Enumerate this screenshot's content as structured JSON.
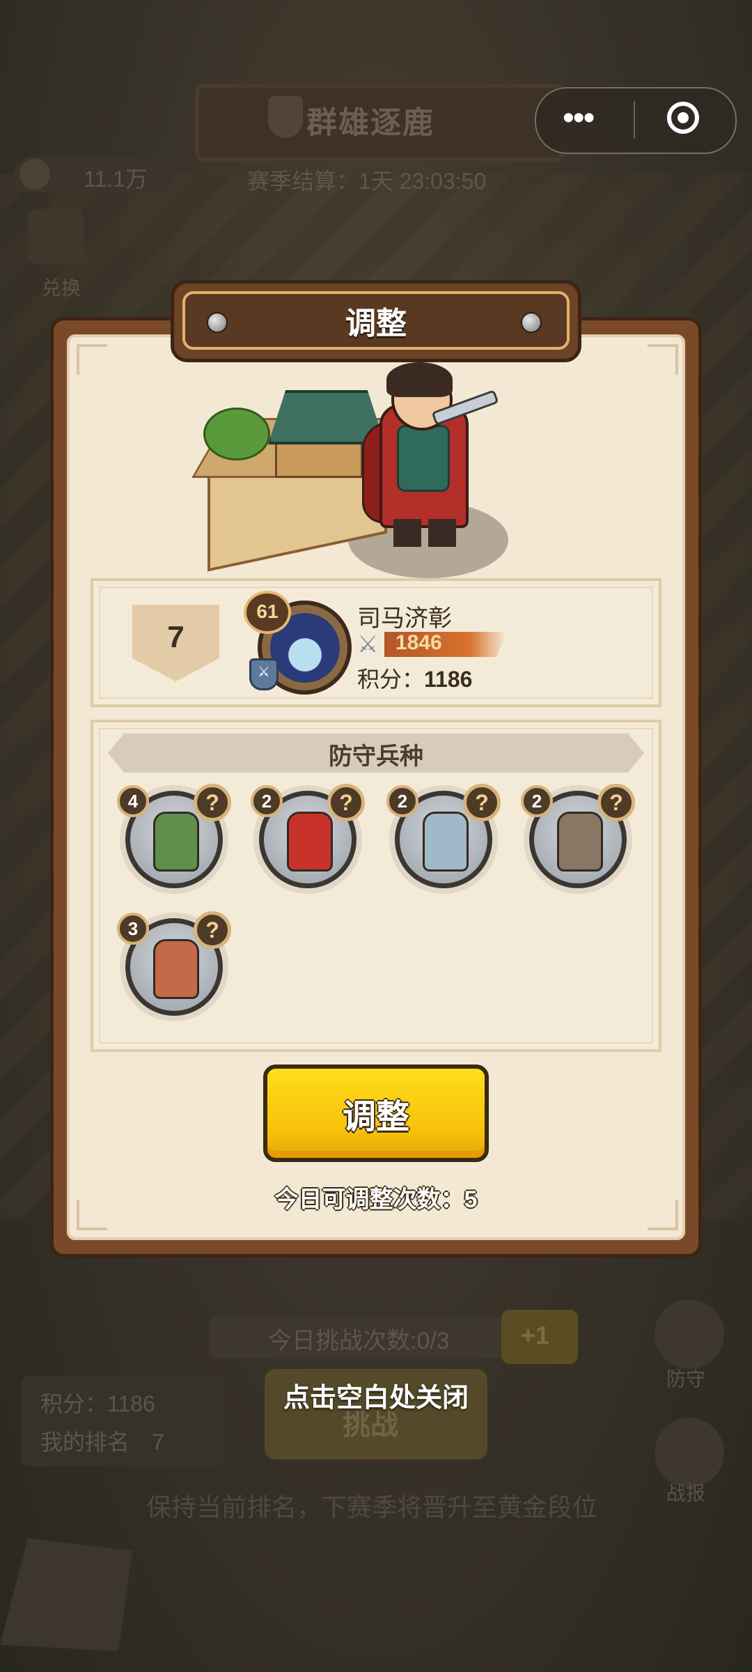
{
  "background": {
    "mode_title": "群雄逐鹿",
    "season_timer": "赛季结算：1天 23:03:50",
    "resource_value": "11.1万",
    "exchange_label": "兑换",
    "challenge_count": "今日挑战次数:0/3",
    "plus_label": "+1",
    "score_text": "积分：1186",
    "rank_text": "我的排名　7",
    "challenge_button": "挑战",
    "defend_label": "防守",
    "report_label": "战报",
    "promotion_text": "保持当前排名，下赛季将晋升至黄金段位"
  },
  "capsule": {
    "more_glyph": "•••"
  },
  "dialog": {
    "title": "调整",
    "player": {
      "rank": "7",
      "level": "61",
      "name": "司马济彰",
      "power": "1846",
      "score_label": "积分：",
      "score": "1186"
    },
    "defense": {
      "title": "防守兵种",
      "units": [
        {
          "count": "4",
          "help": "?",
          "icon": "cavalry-spearman",
          "color": "#5f8f4a"
        },
        {
          "count": "2",
          "help": "?",
          "icon": "fire-mage",
          "color": "#c9322a"
        },
        {
          "count": "2",
          "help": "?",
          "icon": "ice-sage",
          "color": "#9fb9c9"
        },
        {
          "count": "2",
          "help": "?",
          "icon": "trident-soldier",
          "color": "#8a7665"
        },
        {
          "count": "3",
          "help": "?",
          "icon": "brute-warrior",
          "color": "#c4694a"
        }
      ]
    },
    "adjust_button": "调整",
    "adjust_remaining": "今日可调整次数：5"
  },
  "close_hint": "点击空白处关闭",
  "colors": {
    "button_yellow": "#f7c10a",
    "panel_cream": "#f3e8d4",
    "frame_brown": "#7a4a28"
  }
}
